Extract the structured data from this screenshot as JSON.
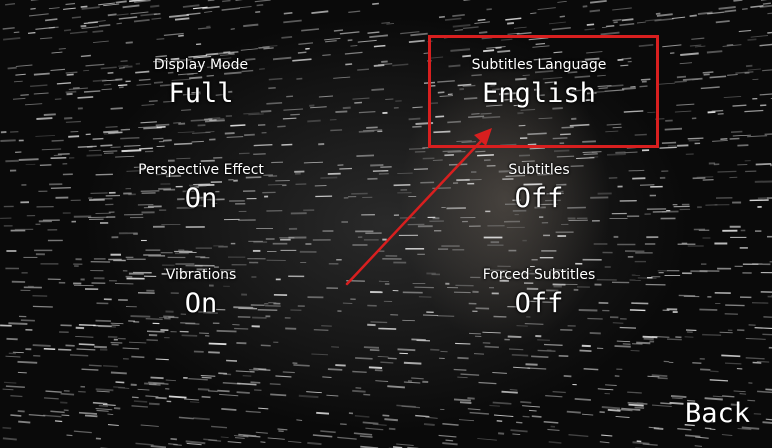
{
  "settings": {
    "display_mode": {
      "label": "Display Mode",
      "value": "Full"
    },
    "subtitles_language": {
      "label": "Subtitles Language",
      "value": "English"
    },
    "perspective_effect": {
      "label": "Perspective Effect",
      "value": "On"
    },
    "subtitles": {
      "label": "Subtitles",
      "value": "Off"
    },
    "vibrations": {
      "label": "Vibrations",
      "value": "On"
    },
    "forced_subtitles": {
      "label": "Forced Subtitles",
      "value": "Off"
    }
  },
  "navigation": {
    "back_label": "Back"
  },
  "annotation": {
    "highlight_color": "#d81f1f",
    "arrow_color": "#d81f1f"
  }
}
